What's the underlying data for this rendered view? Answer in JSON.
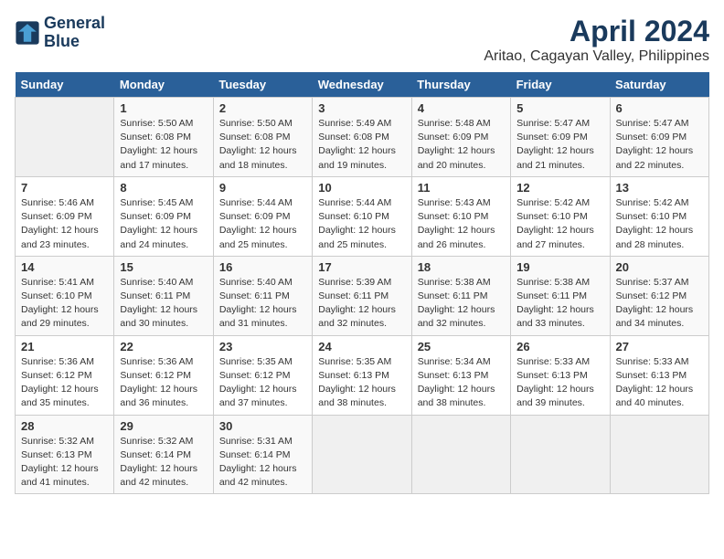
{
  "logo": {
    "line1": "General",
    "line2": "Blue"
  },
  "title": "April 2024",
  "location": "Aritao, Cagayan Valley, Philippines",
  "days_header": [
    "Sunday",
    "Monday",
    "Tuesday",
    "Wednesday",
    "Thursday",
    "Friday",
    "Saturday"
  ],
  "weeks": [
    [
      {
        "num": "",
        "info": ""
      },
      {
        "num": "1",
        "info": "Sunrise: 5:50 AM\nSunset: 6:08 PM\nDaylight: 12 hours\nand 17 minutes."
      },
      {
        "num": "2",
        "info": "Sunrise: 5:50 AM\nSunset: 6:08 PM\nDaylight: 12 hours\nand 18 minutes."
      },
      {
        "num": "3",
        "info": "Sunrise: 5:49 AM\nSunset: 6:08 PM\nDaylight: 12 hours\nand 19 minutes."
      },
      {
        "num": "4",
        "info": "Sunrise: 5:48 AM\nSunset: 6:09 PM\nDaylight: 12 hours\nand 20 minutes."
      },
      {
        "num": "5",
        "info": "Sunrise: 5:47 AM\nSunset: 6:09 PM\nDaylight: 12 hours\nand 21 minutes."
      },
      {
        "num": "6",
        "info": "Sunrise: 5:47 AM\nSunset: 6:09 PM\nDaylight: 12 hours\nand 22 minutes."
      }
    ],
    [
      {
        "num": "7",
        "info": "Sunrise: 5:46 AM\nSunset: 6:09 PM\nDaylight: 12 hours\nand 23 minutes."
      },
      {
        "num": "8",
        "info": "Sunrise: 5:45 AM\nSunset: 6:09 PM\nDaylight: 12 hours\nand 24 minutes."
      },
      {
        "num": "9",
        "info": "Sunrise: 5:44 AM\nSunset: 6:09 PM\nDaylight: 12 hours\nand 25 minutes."
      },
      {
        "num": "10",
        "info": "Sunrise: 5:44 AM\nSunset: 6:10 PM\nDaylight: 12 hours\nand 25 minutes."
      },
      {
        "num": "11",
        "info": "Sunrise: 5:43 AM\nSunset: 6:10 PM\nDaylight: 12 hours\nand 26 minutes."
      },
      {
        "num": "12",
        "info": "Sunrise: 5:42 AM\nSunset: 6:10 PM\nDaylight: 12 hours\nand 27 minutes."
      },
      {
        "num": "13",
        "info": "Sunrise: 5:42 AM\nSunset: 6:10 PM\nDaylight: 12 hours\nand 28 minutes."
      }
    ],
    [
      {
        "num": "14",
        "info": "Sunrise: 5:41 AM\nSunset: 6:10 PM\nDaylight: 12 hours\nand 29 minutes."
      },
      {
        "num": "15",
        "info": "Sunrise: 5:40 AM\nSunset: 6:11 PM\nDaylight: 12 hours\nand 30 minutes."
      },
      {
        "num": "16",
        "info": "Sunrise: 5:40 AM\nSunset: 6:11 PM\nDaylight: 12 hours\nand 31 minutes."
      },
      {
        "num": "17",
        "info": "Sunrise: 5:39 AM\nSunset: 6:11 PM\nDaylight: 12 hours\nand 32 minutes."
      },
      {
        "num": "18",
        "info": "Sunrise: 5:38 AM\nSunset: 6:11 PM\nDaylight: 12 hours\nand 32 minutes."
      },
      {
        "num": "19",
        "info": "Sunrise: 5:38 AM\nSunset: 6:11 PM\nDaylight: 12 hours\nand 33 minutes."
      },
      {
        "num": "20",
        "info": "Sunrise: 5:37 AM\nSunset: 6:12 PM\nDaylight: 12 hours\nand 34 minutes."
      }
    ],
    [
      {
        "num": "21",
        "info": "Sunrise: 5:36 AM\nSunset: 6:12 PM\nDaylight: 12 hours\nand 35 minutes."
      },
      {
        "num": "22",
        "info": "Sunrise: 5:36 AM\nSunset: 6:12 PM\nDaylight: 12 hours\nand 36 minutes."
      },
      {
        "num": "23",
        "info": "Sunrise: 5:35 AM\nSunset: 6:12 PM\nDaylight: 12 hours\nand 37 minutes."
      },
      {
        "num": "24",
        "info": "Sunrise: 5:35 AM\nSunset: 6:13 PM\nDaylight: 12 hours\nand 38 minutes."
      },
      {
        "num": "25",
        "info": "Sunrise: 5:34 AM\nSunset: 6:13 PM\nDaylight: 12 hours\nand 38 minutes."
      },
      {
        "num": "26",
        "info": "Sunrise: 5:33 AM\nSunset: 6:13 PM\nDaylight: 12 hours\nand 39 minutes."
      },
      {
        "num": "27",
        "info": "Sunrise: 5:33 AM\nSunset: 6:13 PM\nDaylight: 12 hours\nand 40 minutes."
      }
    ],
    [
      {
        "num": "28",
        "info": "Sunrise: 5:32 AM\nSunset: 6:13 PM\nDaylight: 12 hours\nand 41 minutes."
      },
      {
        "num": "29",
        "info": "Sunrise: 5:32 AM\nSunset: 6:14 PM\nDaylight: 12 hours\nand 42 minutes."
      },
      {
        "num": "30",
        "info": "Sunrise: 5:31 AM\nSunset: 6:14 PM\nDaylight: 12 hours\nand 42 minutes."
      },
      {
        "num": "",
        "info": ""
      },
      {
        "num": "",
        "info": ""
      },
      {
        "num": "",
        "info": ""
      },
      {
        "num": "",
        "info": ""
      }
    ]
  ]
}
